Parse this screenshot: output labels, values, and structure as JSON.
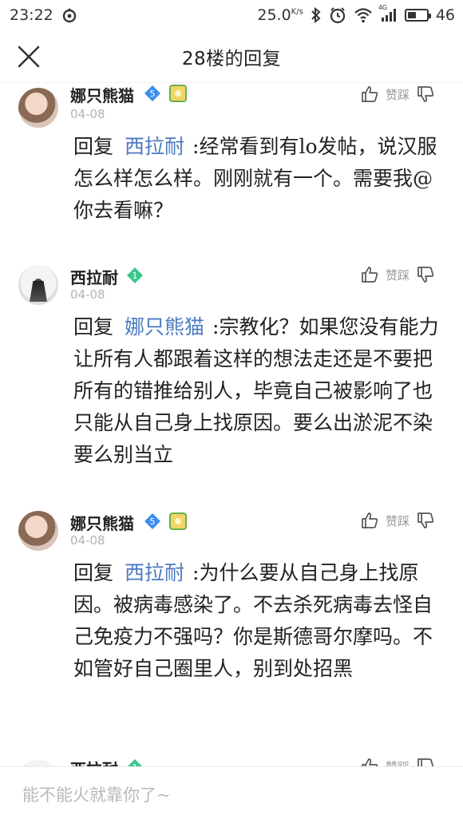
{
  "status_bar": {
    "time": "23:22",
    "speed_value": "25.0",
    "speed_unit": "K/s",
    "network_type": "4G",
    "battery_level": "46",
    "battery_fraction": 0.46
  },
  "header": {
    "title": "28楼的回复"
  },
  "replies": [
    {
      "username": "娜只熊猫",
      "level": "5",
      "date": "04-08",
      "like_label": "赞踩",
      "reply_prefix": "回复",
      "mention": "西拉耐",
      "text": ":经常看到有lo发帖，说汉服怎么样怎么样。刚刚就有一个。需要我@你去看嘛？"
    },
    {
      "username": "西拉耐",
      "level": "1",
      "date": "04-08",
      "like_label": "赞踩",
      "reply_prefix": "回复",
      "mention": "娜只熊猫",
      "text": ":宗教化？如果您没有能力让所有人都跟着这样的想法走还是不要把所有的错推给别人，毕竟自己被影响了也只能从自己身上找原因。要么出淤泥不染要么别当立"
    },
    {
      "username": "娜只熊猫",
      "level": "5",
      "date": "04-08",
      "like_label": "赞踩",
      "reply_prefix": "回复",
      "mention": "西拉耐",
      "text": ":为什么要从自己身上找原因。被病毒感染了。不去杀死病毒去怪自己免疫力不强吗？你是斯德哥尔摩吗。不如管好自己圈里人，别到处招黑"
    },
    {
      "username": "西拉耐",
      "level": "1",
      "like_label": "赞踩"
    }
  ],
  "input": {
    "placeholder": "能不能火就靠你了~"
  },
  "colors": {
    "mention": "#4b7ac2",
    "level5_badge": "#3b8ef0",
    "level1_badge": "#3cc78a",
    "meta_gray": "#b3b3b3"
  }
}
